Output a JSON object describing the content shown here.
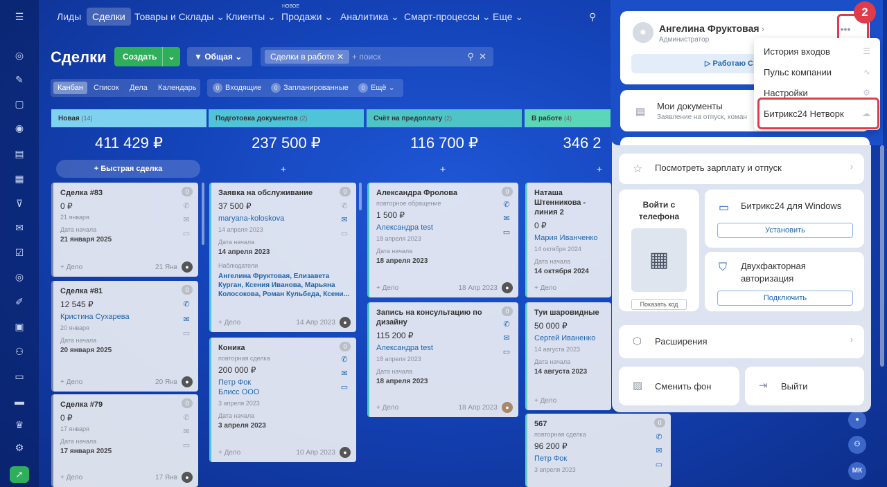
{
  "topnav": {
    "items": [
      {
        "label": "Лиды"
      },
      {
        "label": "Сделки"
      },
      {
        "label": "Товары и Склады"
      },
      {
        "label": "Клиенты"
      },
      {
        "label": "Продажи"
      },
      {
        "label": "Аналитика"
      },
      {
        "label": "Смарт-процессы"
      },
      {
        "label": "Еще"
      }
    ],
    "new_tag": "НОВОЕ"
  },
  "header": {
    "title": "Сделки",
    "create_label": "Создать",
    "pipeline_label": "Общая",
    "filter_chip": "Сделки в работе",
    "search_placeholder": "+ поиск"
  },
  "view_tabs": [
    "Канбан",
    "Список",
    "Дела",
    "Календарь"
  ],
  "counters": [
    {
      "num": "0",
      "label": "Входящие"
    },
    {
      "num": "0",
      "label": "Запланированные"
    },
    {
      "num": "0",
      "label": "Ещё"
    }
  ],
  "columns": [
    {
      "title": "Новая",
      "count": "(14)",
      "sum": "411 429 ₽",
      "color": "#7fd1f0"
    },
    {
      "title": "Подготовка документов",
      "count": "(2)",
      "sum": "237 500 ₽",
      "color": "#4fc3d8"
    },
    {
      "title": "Счёт на предоплату",
      "count": "(2)",
      "sum": "116 700 ₽",
      "color": "#4ec4c7"
    },
    {
      "title": "В работе",
      "count": "(4)",
      "sum": "346 2",
      "color": "#5cd6b8"
    }
  ],
  "quick_deal": "Быстрая сделка",
  "labels": {
    "start_date": "Дата начала",
    "observers": "Наблюдатели",
    "add_activity": "+ Дело"
  },
  "cards": {
    "c83": {
      "title": "Сделка #83",
      "sum": "0 ₽",
      "date": "21 января",
      "start": "21 января 2025",
      "fdate": "21 Янв",
      "badge": "0"
    },
    "c81": {
      "title": "Сделка #81",
      "sum": "12 545 ₽",
      "contact": "Кристина Сухарева",
      "date": "20 января",
      "start": "20 января 2025",
      "fdate": "20 Янв",
      "badge": "0"
    },
    "c79": {
      "title": "Сделка #79",
      "sum": "0 ₽",
      "date": "17 января",
      "start": "17 января 2025",
      "fdate": "17 Янв",
      "badge": "0"
    },
    "zayavka": {
      "title": "Заявка на обслуживание",
      "sum": "37 500 ₽",
      "contact": "maryana-koloskova",
      "date": "14 апреля 2023",
      "start": "14 апреля 2023",
      "observers": "Ангелина Фруктовая, Елизавета Курган, Ксения Иванова, Марьяна Колосокова, Роман Кульбеда, Ксени...",
      "fdate": "14 Апр 2023",
      "badge": "0"
    },
    "konika": {
      "title": "Коника",
      "sub": "повторная сделка",
      "sum": "200 000 ₽",
      "contact": "Петр Фок",
      "company": "Блисс ООО",
      "date": "3 апреля 2023",
      "start": "3 апреля 2023",
      "fdate": "10 Апр 2023",
      "badge": "0"
    },
    "frolova": {
      "title": "Александра Фролова",
      "sub": "повторное обращение",
      "sum": "1 500 ₽",
      "contact": "Александра test",
      "date": "18 апреля 2023",
      "start": "18 апреля 2023",
      "fdate": "18 Апр 2023",
      "badge": "0"
    },
    "zapis": {
      "title": "Запись на консультацию по дизайну",
      "sum": "115 200 ₽",
      "contact": "Александра test",
      "date": "18 апреля 2023",
      "start": "18 апреля 2023",
      "fdate": "18 Апр 2023",
      "badge": "0"
    },
    "natasha": {
      "title": "Наташа Штенникова - линия 2",
      "sum": "0 ₽",
      "contact": "Мария Иванченко",
      "date": "14 октября 2024",
      "start": "14 октября 2024",
      "fdate": "",
      "badge": ""
    },
    "tui": {
      "title": "Туи шаровидные",
      "sum": "50 000 ₽",
      "contact": "Сергей Иваненко",
      "date": "14 августа 2023",
      "start": "14 августа 2023",
      "badge": "0"
    },
    "c567": {
      "title": "567",
      "sub": "повторная сделка",
      "sum": "96 200 ₽",
      "contact": "Петр Фок",
      "date": "3 апреля 2023",
      "badge": "0"
    }
  },
  "profile": {
    "name": "Ангелина Фруктовая",
    "role": "Администратор",
    "work_button": "Работаю С",
    "docs_title": "Мои документы",
    "docs_sub": "Заявление на отпуск, коман",
    "salary": "Посмотреть зарплату и отпуск",
    "phone_login": "Войти с телефона",
    "show_code": "Показать код",
    "win_title": "Битрикс24 для Windows",
    "win_button": "Установить",
    "twofa_title": "Двухфакторная авторизация",
    "twofa_button": "Подключить",
    "extensions": "Расширения",
    "change_bg": "Сменить фон",
    "logout": "Выйти"
  },
  "menu": {
    "items": [
      "История входов",
      "Пульс компании",
      "Настройки",
      "Битрикс24 Нетворк"
    ],
    "step": "2"
  },
  "right_rail": {
    "initials": "МК"
  }
}
